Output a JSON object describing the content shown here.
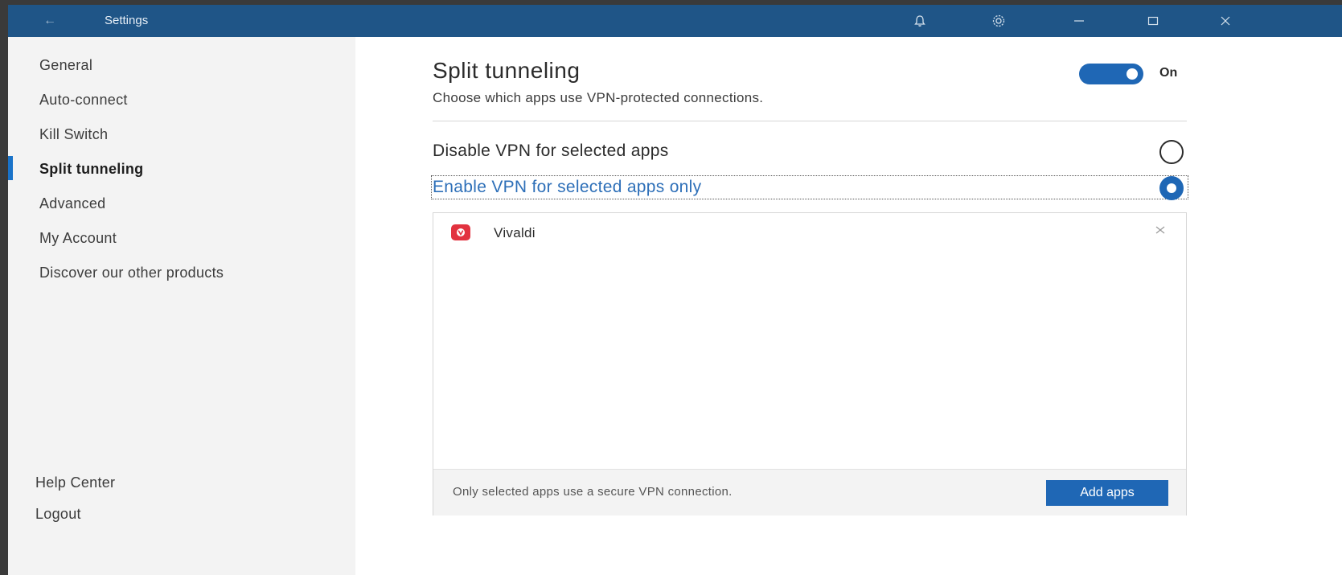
{
  "window": {
    "title": "Settings",
    "back_glyph": "←"
  },
  "titlebar_icons": [
    {
      "name": "bell-icon"
    },
    {
      "name": "gear-icon"
    },
    {
      "name": "minimize-icon"
    },
    {
      "name": "maximize-icon"
    },
    {
      "name": "close-icon"
    }
  ],
  "sidebar": {
    "items": [
      {
        "label": "General"
      },
      {
        "label": "Auto-connect"
      },
      {
        "label": "Kill Switch"
      },
      {
        "label": "Split tunneling",
        "active": true
      },
      {
        "label": "Advanced"
      },
      {
        "label": "My Account"
      },
      {
        "label": "Discover our other products"
      }
    ],
    "footer": [
      {
        "label": "Help Center"
      },
      {
        "label": "Logout"
      }
    ]
  },
  "main": {
    "title": "Split tunneling",
    "subtitle": "Choose which apps use VPN-protected connections.",
    "toggle": {
      "label": "On",
      "on": true
    },
    "options": [
      {
        "label": "Disable VPN for selected apps",
        "checked": false
      },
      {
        "label": "Enable VPN for selected apps only",
        "checked": true
      }
    ],
    "apps": [
      {
        "name": "Vivaldi",
        "icon": "vivaldi-icon"
      }
    ],
    "footer_note": "Only selected apps use a secure VPN connection.",
    "add_button": "Add apps"
  },
  "colors": {
    "titlebar": "#1f5587",
    "accent": "#1f67b5",
    "app_icon": "#e2323f"
  }
}
